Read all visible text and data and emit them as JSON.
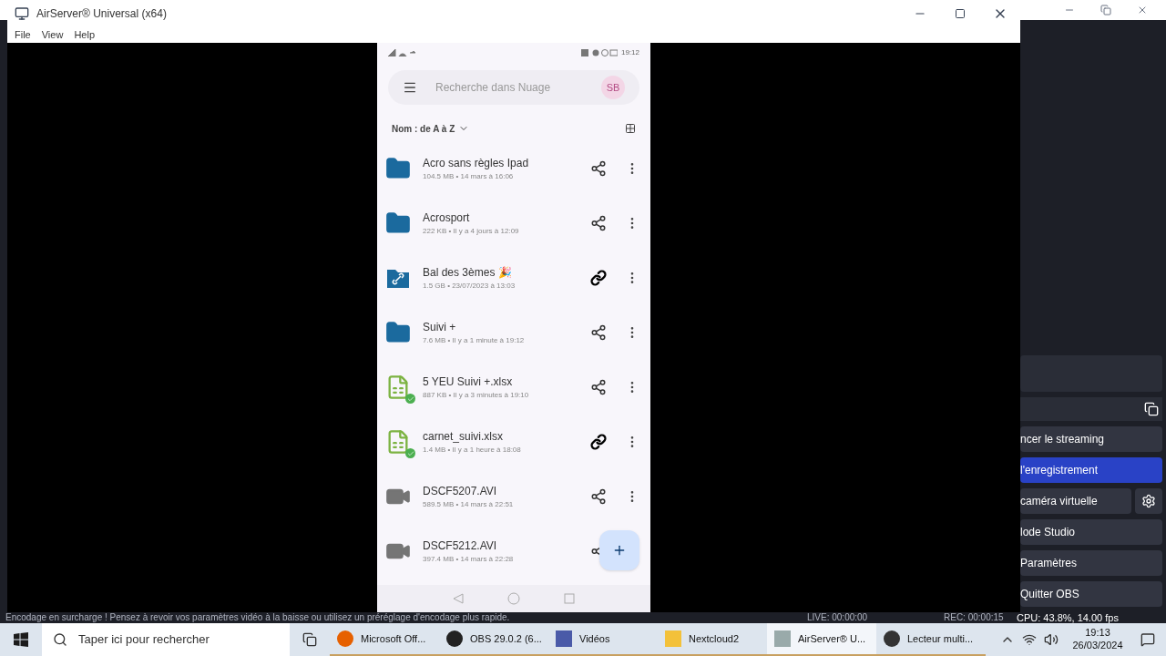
{
  "obs_window": {
    "buttons": [
      {
        "label": "ncer le streaming",
        "selected": false,
        "settings_button": false
      },
      {
        "label": "l'enregistrement",
        "selected": true,
        "settings_button": false
      },
      {
        "label": "caméra virtuelle",
        "selected": false,
        "settings_button": true
      },
      {
        "label": "lode Studio",
        "selected": false,
        "settings_button": false
      },
      {
        "label": "Paramètres",
        "selected": false,
        "settings_button": false
      },
      {
        "label": "Quitter OBS",
        "selected": false,
        "settings_button": false
      }
    ],
    "status": {
      "warning": "Encodage en surcharge ! Pensez à revoir vos paramètres vidéo à la baisse ou utilisez un préréglage d'encodage plus rapide.",
      "live": "LIVE: 00:00:00",
      "rec": "REC: 00:00:15",
      "cpu": "CPU: 43.8%, 14.00 fps"
    }
  },
  "airserver": {
    "title": "AirServer® Universal (x64)",
    "menu": [
      "File",
      "View",
      "Help"
    ]
  },
  "phone": {
    "time": "19:12",
    "search_placeholder": "Recherche dans Nuage",
    "avatar": "SB",
    "sort": "Nom : de A à Z",
    "files": [
      {
        "name": "Acro sans règles Ipad",
        "meta": "104.5 MB • 14 mars à 16:06",
        "kind": "folder",
        "link_shared": false,
        "synced": false
      },
      {
        "name": "Acrosport",
        "meta": "222 KB • Il y a 4 jours à 12:09",
        "kind": "folder",
        "link_shared": false,
        "synced": false
      },
      {
        "name": "Bal des 3èmes 🎉",
        "meta": "1.5 GB • 23/07/2023 à 13:03",
        "kind": "linked-folder",
        "link_shared": true,
        "synced": false
      },
      {
        "name": "Suivi +",
        "meta": "7.6 MB • Il y a 1 minute à 19:12",
        "kind": "folder",
        "link_shared": false,
        "synced": false
      },
      {
        "name": "5 YEU Suivi +.xlsx",
        "meta": "887 KB • Il y a 3 minutes à 19:10",
        "kind": "spreadsheet",
        "link_shared": false,
        "synced": true
      },
      {
        "name": "carnet_suivi.xlsx",
        "meta": "1.4 MB • Il y a 1 heure à 18:08",
        "kind": "spreadsheet",
        "link_shared": true,
        "synced": true
      },
      {
        "name": "DSCF5207.AVI",
        "meta": "589.5 MB • 14 mars à 22:51",
        "kind": "video",
        "link_shared": false,
        "synced": false
      },
      {
        "name": "DSCF5212.AVI",
        "meta": "397.4 MB • 14 mars à 22:28",
        "kind": "video",
        "link_shared": false,
        "synced": false
      }
    ]
  },
  "taskbar": {
    "search_placeholder": "Taper ici pour rechercher",
    "apps": [
      {
        "label": "Microsoft Off...",
        "kind": "browser",
        "selected": false
      },
      {
        "label": "OBS 29.0.2 (6...",
        "kind": "obs",
        "selected": false
      },
      {
        "label": "Vidéos",
        "kind": "video",
        "selected": false
      },
      {
        "label": "Nextcloud2",
        "kind": "folder",
        "selected": false
      },
      {
        "label": "AirServer® U...",
        "kind": "airserver",
        "selected": true
      },
      {
        "label": "Lecteur multi...",
        "kind": "player",
        "selected": false
      }
    ],
    "time": "19:13",
    "date": "26/03/2024"
  }
}
